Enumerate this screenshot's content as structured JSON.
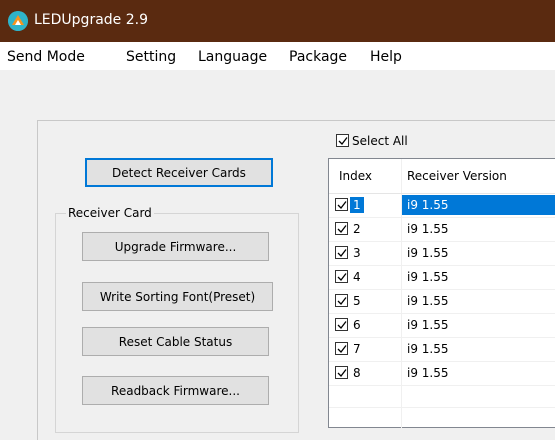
{
  "window": {
    "title": "LEDUpgrade 2.9",
    "title_bar_color": "#5a2a10",
    "app_icon": "led-upgrade-app-icon"
  },
  "menu": {
    "items": [
      "Send Mode",
      "Setting",
      "Language",
      "Package",
      "Help"
    ]
  },
  "buttons": {
    "detect": "Detect Receiver Cards"
  },
  "receiver_card_group": {
    "label": "Receiver Card",
    "buttons": {
      "upgrade": "Upgrade Firmware...",
      "write_font": "Write Sorting Font(Preset)",
      "reset_cable": "Reset Cable Status",
      "readback": "Readback Firmware..."
    }
  },
  "select_all": {
    "label": "Select All",
    "checked": true
  },
  "table": {
    "columns": [
      "Index",
      "Receiver Version"
    ],
    "rows": [
      {
        "index": "1",
        "version": "i9 1.55",
        "checked": true,
        "selected": true
      },
      {
        "index": "2",
        "version": "i9 1.55",
        "checked": true,
        "selected": false
      },
      {
        "index": "3",
        "version": "i9 1.55",
        "checked": true,
        "selected": false
      },
      {
        "index": "4",
        "version": "i9 1.55",
        "checked": true,
        "selected": false
      },
      {
        "index": "5",
        "version": "i9 1.55",
        "checked": true,
        "selected": false
      },
      {
        "index": "6",
        "version": "i9 1.55",
        "checked": true,
        "selected": false
      },
      {
        "index": "7",
        "version": "i9 1.55",
        "checked": true,
        "selected": false
      },
      {
        "index": "8",
        "version": "i9 1.55",
        "checked": true,
        "selected": false
      }
    ],
    "selection_color": "#0078d7"
  }
}
